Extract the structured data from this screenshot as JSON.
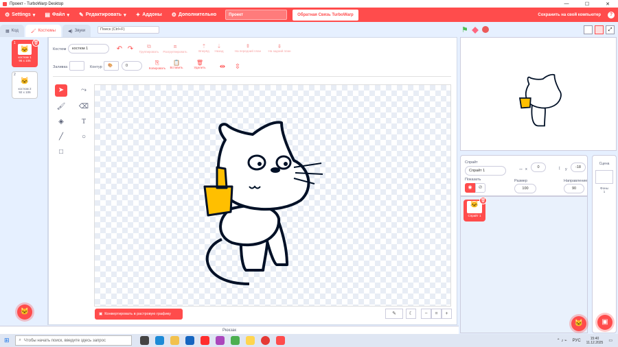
{
  "window": {
    "title": "Проект - TurboWarp Desktop"
  },
  "menu": {
    "settings": "Settings",
    "file": "Файл",
    "edit": "Редактировать",
    "addons": "Аддоны",
    "advanced": "Дополнительно",
    "project_title": "Проект",
    "feedback": "Обратная Связь TurboWarp",
    "save_pc": "Сохранить на свой компьютер"
  },
  "tabs": {
    "code": "Код",
    "costumes": "Костюмы",
    "sounds": "Звуки"
  },
  "search": {
    "placeholder": "Поиск (Ctrl+F)"
  },
  "costumes": [
    {
      "num": "1",
      "name": "костюм 1",
      "size": "96 x 106"
    },
    {
      "num": "2",
      "name": "костюм 2",
      "size": "92 x 106"
    }
  ],
  "editor": {
    "costume_label": "Костюм",
    "costume_name": "костюм 1",
    "fill_label": "Заливка",
    "outline_label": "Контур",
    "outline_value": "0",
    "group": "Группировать",
    "ungroup": "Разгруппировать",
    "forward": "Вперёд",
    "backward": "Назад",
    "front": "На передний план",
    "back": "На задний план",
    "copy": "Копировать",
    "paste": "Вставить",
    "delete": "Удалить",
    "convert": "Конвертировать в растровую графику"
  },
  "backpack": "Рюкзак",
  "sprite": {
    "label": "Спрайт",
    "name": "Спрайт 1",
    "x_label": "x",
    "x": "0",
    "y_label": "y",
    "y": "-18",
    "show_label": "Показать",
    "size_label": "Размер",
    "size": "100",
    "direction_label": "Направление",
    "direction": "90",
    "thumb_name": "Спрайт 1"
  },
  "stage_panel": {
    "label": "Сцена",
    "backdrops_label": "Фоны",
    "backdrops_count": "1"
  },
  "taskbar": {
    "search_placeholder": "Чтобы начать поиск, введите здесь запрос",
    "lang": "РУС",
    "time": "15:40",
    "date": "11.12.2025"
  },
  "colors": {
    "accent": "#ff4c4c",
    "background": "#e6f0ff"
  }
}
